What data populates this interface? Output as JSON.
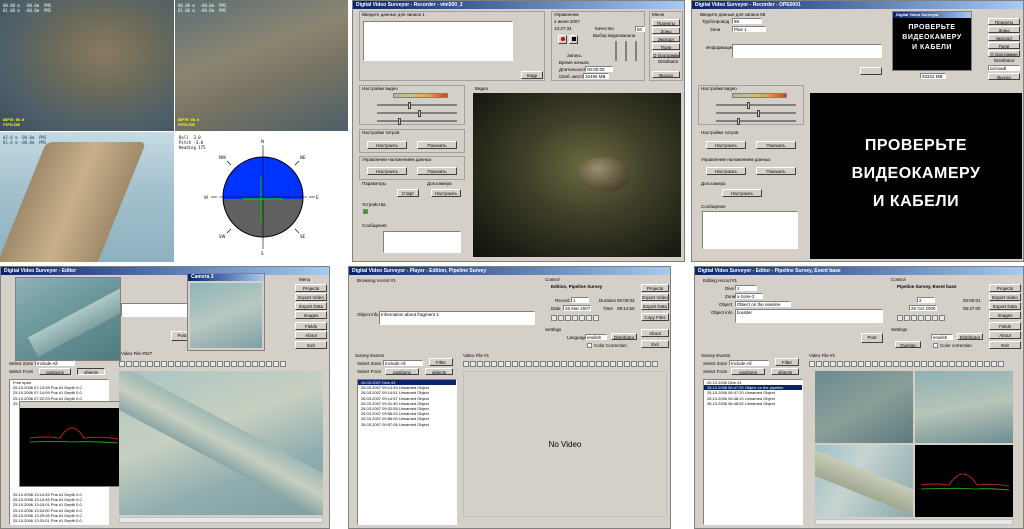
{
  "cam_quad": {
    "osd_tl": "00.00 m  -00.0m  PMS\n01.00 m  -00.0m  PMS",
    "osd_tr": "00.00 m  -00.0m  PMS\n01.00 m  -00.0m  PMS",
    "osd_bl": "02.0 m -00.0m  PMS\n01.0 m -00.0m  PMS",
    "osd_y1": "DEPTH 00.0",
    "osd_y2": "PIPELINE",
    "osd_y3": "DEPTH 00.0",
    "osd_y4": "PIPELINE",
    "attitude_readout": "Roll  3.0\nPitch -3.0\nHeading 175",
    "compass_labels": [
      "N",
      "NE",
      "E",
      "SE",
      "S",
      "SW",
      "W",
      "NW"
    ]
  },
  "recorder": {
    "title": "Digital Video Surveyor - Recorder - vim500_2",
    "enter_record_label": "Введите данные для записи 1",
    "control_label": "Управление",
    "date": "4 июня 2007",
    "time": "13:27:34",
    "quality_label": "Качество",
    "quality_value": "50",
    "video_choice_label": "Выбор видеоканала",
    "recording_label": "Запись",
    "time_label": "Время начала",
    "duration_label": "Длительность",
    "duration_value": "00:00:00",
    "free_space_label": "Своб. место",
    "free_space_value": "16496 MB",
    "cadr_button": "Кадр",
    "menu_label": "Меню",
    "menu_items": [
      "Проекты",
      "Зоны",
      "Экспорт",
      "Поле",
      "О программе",
      "Distributor",
      "Выход"
    ],
    "settings_video": "Настройки видео",
    "settings_title": "Настройки титров",
    "tune_button": "Настроить",
    "show_button": "Показать",
    "overlay_label": "Управление наложением данных",
    "params_label": "Параметры",
    "start_button": "Старт",
    "extra_label": "Доп.камера",
    "devices_label": "Устройства",
    "messages_label": "Сообщения",
    "video_label": "Видео"
  },
  "recorder2": {
    "title": "Digital Video Surveyor - Recorder - OPE0001",
    "enter_record_label": "Введите данные для записи 56",
    "pipeline_label": "Трубопровод",
    "pipeline_value": "88",
    "zone_label": "Зона",
    "zone_value": "Pipe 1",
    "info_label": "Информация",
    "preview_title": "Digital Video Surveyor",
    "preview_line1": "ПРОВЕРЬТЕ",
    "preview_line2": "ВИДЕОКАМЕРУ",
    "preview_line3": "И КАБЕЛИ",
    "free_space_value": "93322 MB",
    "menu_items": [
      "Проекты",
      "Зоны",
      "Экспорт",
      "Поле",
      "О программе",
      "Distributor",
      "русский",
      "Выход"
    ],
    "big_line1": "ПРОВЕРЬТЕ",
    "big_line2": "ВИДЕОКАМЕРУ",
    "big_line3": "И КАБЕЛИ",
    "settings_video": "Настройки видео",
    "settings_title": "Настройки титров",
    "overlay_label": "Управление наложением данных",
    "extra_label": "Доп.камера",
    "messages_label": "Сообщения",
    "tune_button": "Настроить",
    "show_button": "Показать"
  },
  "editor1": {
    "title": "Digital Video Surveyor - Editor",
    "camera_title": "Camera 3",
    "menu_label": "Menu",
    "menu_items": [
      "Projects",
      "Export Video",
      "Export Data",
      "Images",
      "Fields",
      "About",
      "Exit"
    ],
    "post_button": "Post",
    "select_zone_label": "Select Zone",
    "select_zone_value": "Include All",
    "select_from_label": "Select From",
    "positions_button": "positions",
    "objects_button": "objects",
    "video_file_label": "Video File #027",
    "tree_root": "Free span",
    "tree_items": [
      "25.10.2006 07:13:08 Pos #1 Depth 0.0",
      "25.10.2006 07:14:09 Pos #1 Depth 0.0",
      "25.10.2006 07:22:03 Pos #1 Depth 0.0",
      "25.10.2006 07:23:08 Pos #1 Depth 0.0"
    ],
    "tree_items2": [
      "25.10.2006 13:14:45 Pos #1 Depth 0.0",
      "25.10.2006 13:14:46 Pos #1 Depth 0.0",
      "25.10.2006 13:15:01 Pos #1 Depth 0.0",
      "25.10.2006 13:24:00 Pos #1 Depth 0.0",
      "25.10.2006 13:29:06 Pos #1 Depth 0.0",
      "25.10.2006 13:31:01 Pos #1 Depth 0.0"
    ]
  },
  "player": {
    "title": "Digital Video Surveyor - Player - Edition, Pipeline Survey",
    "browsing_label": "Browsing record #1",
    "control_label": "Control",
    "control_name": "Edition, Pipeline Survey",
    "record_label": "Record",
    "record_value": "1",
    "duration_label": "Duration",
    "duration_value": "00:00:03",
    "date_label": "Date",
    "date_value": "26 Mar 2007",
    "time_label": "Time",
    "time_value": "09:14:50",
    "object_info_label": "Object info",
    "object_info_value": "Information about fragment 1",
    "settings_label": "Settings",
    "language_label": "Language",
    "language_value": "english",
    "distributor_button": "Distributor",
    "color_correction_label": "Color Correction",
    "copy_files_button": "Copy Files",
    "menu_items": [
      "Projects",
      "Export Video",
      "Export Data",
      "Copy Files",
      "About",
      "Exit"
    ],
    "survey_events_label": "Survey Events",
    "select_zone_label": "Select Zone",
    "select_zone_value": "Include All",
    "filter_button": "Filter",
    "select_from_label": "Select From",
    "positions_button": "positions",
    "objects_button": "objects",
    "video_file_label": "Video File #1",
    "no_video_label": "No Video",
    "events": [
      "26.03.2007 09:14:45 Unnamed Object",
      "26.03.2007 09:14:51 Unnamed Object",
      "26.03.2007 09:14:57 Unnamed Object",
      "26.03.2007 09:31:40 Unnamed Object",
      "26.03.2007 09:32:55 Unnamed Object",
      "26.03.2007 09:55:20 Unnamed Object",
      "26.03.2007 09:56:00 Unnamed Object",
      "26.03.2007 09:57:06 Unnamed Object"
    ],
    "events_root": "26.03.2007 Dive #1"
  },
  "editor2": {
    "title": "Digital Video Surveyor - Editor - Pipeline Survey, Event base",
    "editing_label": "Editing record #1",
    "dive_label": "Dive",
    "dive_value": "1",
    "zone_label": "Zone",
    "zone_value": "x-zone-2",
    "object_label": "Object",
    "object_value": "Object on the pipeline",
    "object_info_label": "Object info",
    "object_info_value": "boulder",
    "control_label": "Control",
    "control_name": "Pipeline Survey, Event base",
    "record_value": "2",
    "duration_value": "00:00:01",
    "date_value": "26 Oct 2006",
    "time_value": "06:47:00",
    "post_button": "Post",
    "settings_label": "Settings",
    "overlap_button": "Overlap",
    "language_value": "english",
    "distributor_button": "Distributor",
    "color_correction_label": "Color correction",
    "menu_items": [
      "Projects",
      "Export Video",
      "Export Data",
      "Images",
      "Fields",
      "About",
      "Exit"
    ],
    "survey_events_label": "Survey Events",
    "select_zone_label": "Select Zone",
    "select_zone_value": "Include All",
    "filter_button": "Filter",
    "select_from_label": "Select From",
    "positions_button": "positions",
    "objects_button": "objects",
    "video_file_label": "Video File #1",
    "events_root": "25.10.2006 Dive #1",
    "events": [
      "26.10.2006 06:47:00 Object on the pipeline",
      "26.10.2006 06:47:20 Unnamed Object",
      "26.10.2006 06:48:10 Unnamed Object",
      "26.10.2006 06:48:52 Unnamed Object"
    ]
  }
}
